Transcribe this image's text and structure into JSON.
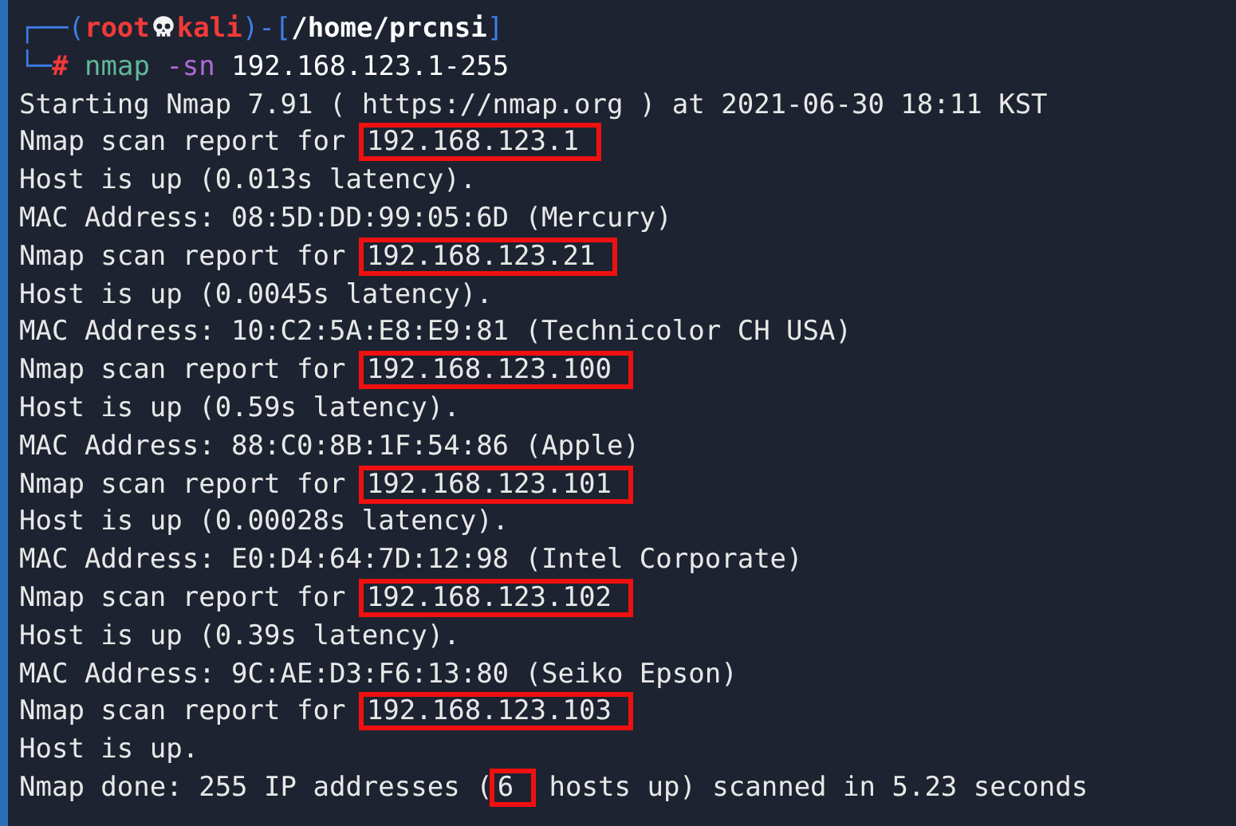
{
  "prompt": {
    "corner_top": "┌──",
    "open": "(",
    "user": "root",
    "host": "kali",
    "close": ")-[",
    "path": "/home/prcnsi",
    "path_close": "]",
    "corner_bottom": "└─",
    "symbol": "#"
  },
  "command": {
    "program": "nmap",
    "flag": "-sn",
    "args": "192.168.123.1-255"
  },
  "output": [
    [
      {
        "text": "Starting Nmap 7.91 ( https://nmap.org ) at 2021-06-30 18:11 KST",
        "highlighted": false
      }
    ],
    [
      {
        "text": "Nmap scan report for ",
        "highlighted": false
      },
      {
        "text": "192.168.123.1",
        "highlighted": true
      }
    ],
    [
      {
        "text": "Host is up (0.013s latency).",
        "highlighted": false
      }
    ],
    [
      {
        "text": "MAC Address: 08:5D:DD:99:05:6D (Mercury)",
        "highlighted": false
      }
    ],
    [
      {
        "text": "Nmap scan report for ",
        "highlighted": false
      },
      {
        "text": "192.168.123.21",
        "highlighted": true
      }
    ],
    [
      {
        "text": "Host is up (0.0045s latency).",
        "highlighted": false
      }
    ],
    [
      {
        "text": "MAC Address: 10:C2:5A:E8:E9:81 (Technicolor CH USA)",
        "highlighted": false
      }
    ],
    [
      {
        "text": "Nmap scan report for ",
        "highlighted": false
      },
      {
        "text": "192.168.123.100",
        "highlighted": true
      }
    ],
    [
      {
        "text": "Host is up (0.59s latency).",
        "highlighted": false
      }
    ],
    [
      {
        "text": "MAC Address: 88:C0:8B:1F:54:86 (Apple)",
        "highlighted": false
      }
    ],
    [
      {
        "text": "Nmap scan report for ",
        "highlighted": false
      },
      {
        "text": "192.168.123.101",
        "highlighted": true
      }
    ],
    [
      {
        "text": "Host is up (0.00028s latency).",
        "highlighted": false
      }
    ],
    [
      {
        "text": "MAC Address: E0:D4:64:7D:12:98 (Intel Corporate)",
        "highlighted": false
      }
    ],
    [
      {
        "text": "Nmap scan report for ",
        "highlighted": false
      },
      {
        "text": "192.168.123.102",
        "highlighted": true
      }
    ],
    [
      {
        "text": "Host is up (0.39s latency).",
        "highlighted": false
      }
    ],
    [
      {
        "text": "MAC Address: 9C:AE:D3:F6:13:80 (Seiko Epson)",
        "highlighted": false
      }
    ],
    [
      {
        "text": "Nmap scan report for ",
        "highlighted": false
      },
      {
        "text": "192.168.123.103",
        "highlighted": true
      }
    ],
    [
      {
        "text": "Host is up.",
        "highlighted": false
      }
    ],
    [
      {
        "text": "Nmap done: 255 IP addresses (",
        "highlighted": false
      },
      {
        "text": "6",
        "highlighted": true
      },
      {
        "text": " hosts up) scanned in 5.23 seconds",
        "highlighted": false
      }
    ]
  ]
}
